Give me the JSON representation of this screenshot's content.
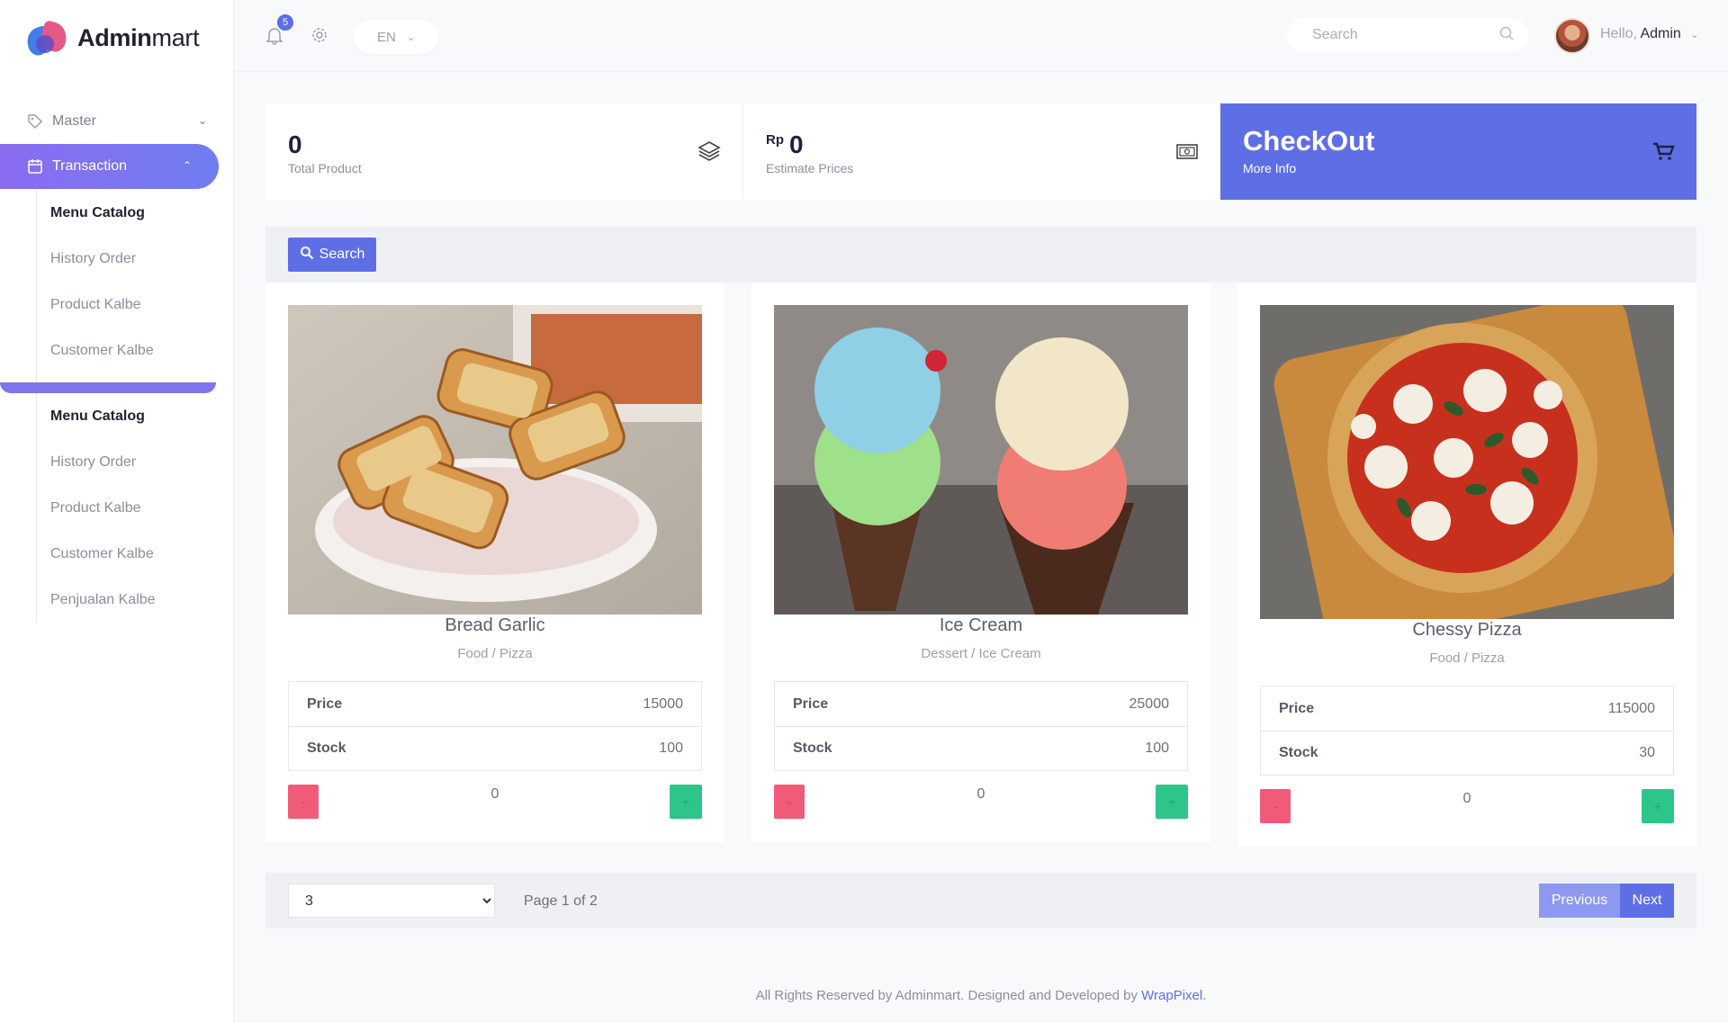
{
  "brand": {
    "name_bold": "Admin",
    "name_rest": "mart"
  },
  "sidebar": {
    "master": {
      "label": "Master",
      "icon": "tag-icon"
    },
    "transaction": {
      "label": "Transaction",
      "icon": "calendar-icon"
    },
    "group1": [
      "Menu Catalog",
      "History Order",
      "Product Kalbe",
      "Customer Kalbe"
    ],
    "group2": [
      "Menu Catalog",
      "History Order",
      "Product Kalbe",
      "Customer Kalbe",
      "Penjualan Kalbe"
    ]
  },
  "topbar": {
    "notifications": "5",
    "language": "EN",
    "search_placeholder": "Search",
    "hello": "Hello,",
    "user": "Admin"
  },
  "stats": {
    "total_product": {
      "value": "0",
      "label": "Total Product"
    },
    "estimate": {
      "currency": "Rp",
      "value": "0",
      "label": "Estimate Prices"
    },
    "checkout": {
      "title": "CheckOut",
      "more": "More Info"
    }
  },
  "search_button": "Search",
  "products": [
    {
      "name": "Bread Garlic",
      "category": "Food / Pizza",
      "price_label": "Price",
      "price": "15000",
      "stock_label": "Stock",
      "stock": "100",
      "qty": "0",
      "minus": "-",
      "plus": "+"
    },
    {
      "name": "Ice Cream",
      "category": "Dessert / Ice Cream",
      "price_label": "Price",
      "price": "25000",
      "stock_label": "Stock",
      "stock": "100",
      "qty": "0",
      "minus": "-",
      "plus": "+"
    },
    {
      "name": "Chessy Pizza",
      "category": "Food / Pizza",
      "price_label": "Price",
      "price": "115000",
      "stock_label": "Stock",
      "stock": "30",
      "qty": "0",
      "minus": "-",
      "plus": "+"
    }
  ],
  "pager": {
    "page_size": "3",
    "info": "Page 1 of 2",
    "prev": "Previous",
    "next": "Next"
  },
  "footer": {
    "text": "All Rights Reserved by Adminmart. Designed and Developed by ",
    "link": "WrapPixel",
    "end": "."
  },
  "colors": {
    "accent": "#5e6fe6",
    "danger": "#f15b7a",
    "success": "#2ec58a"
  }
}
